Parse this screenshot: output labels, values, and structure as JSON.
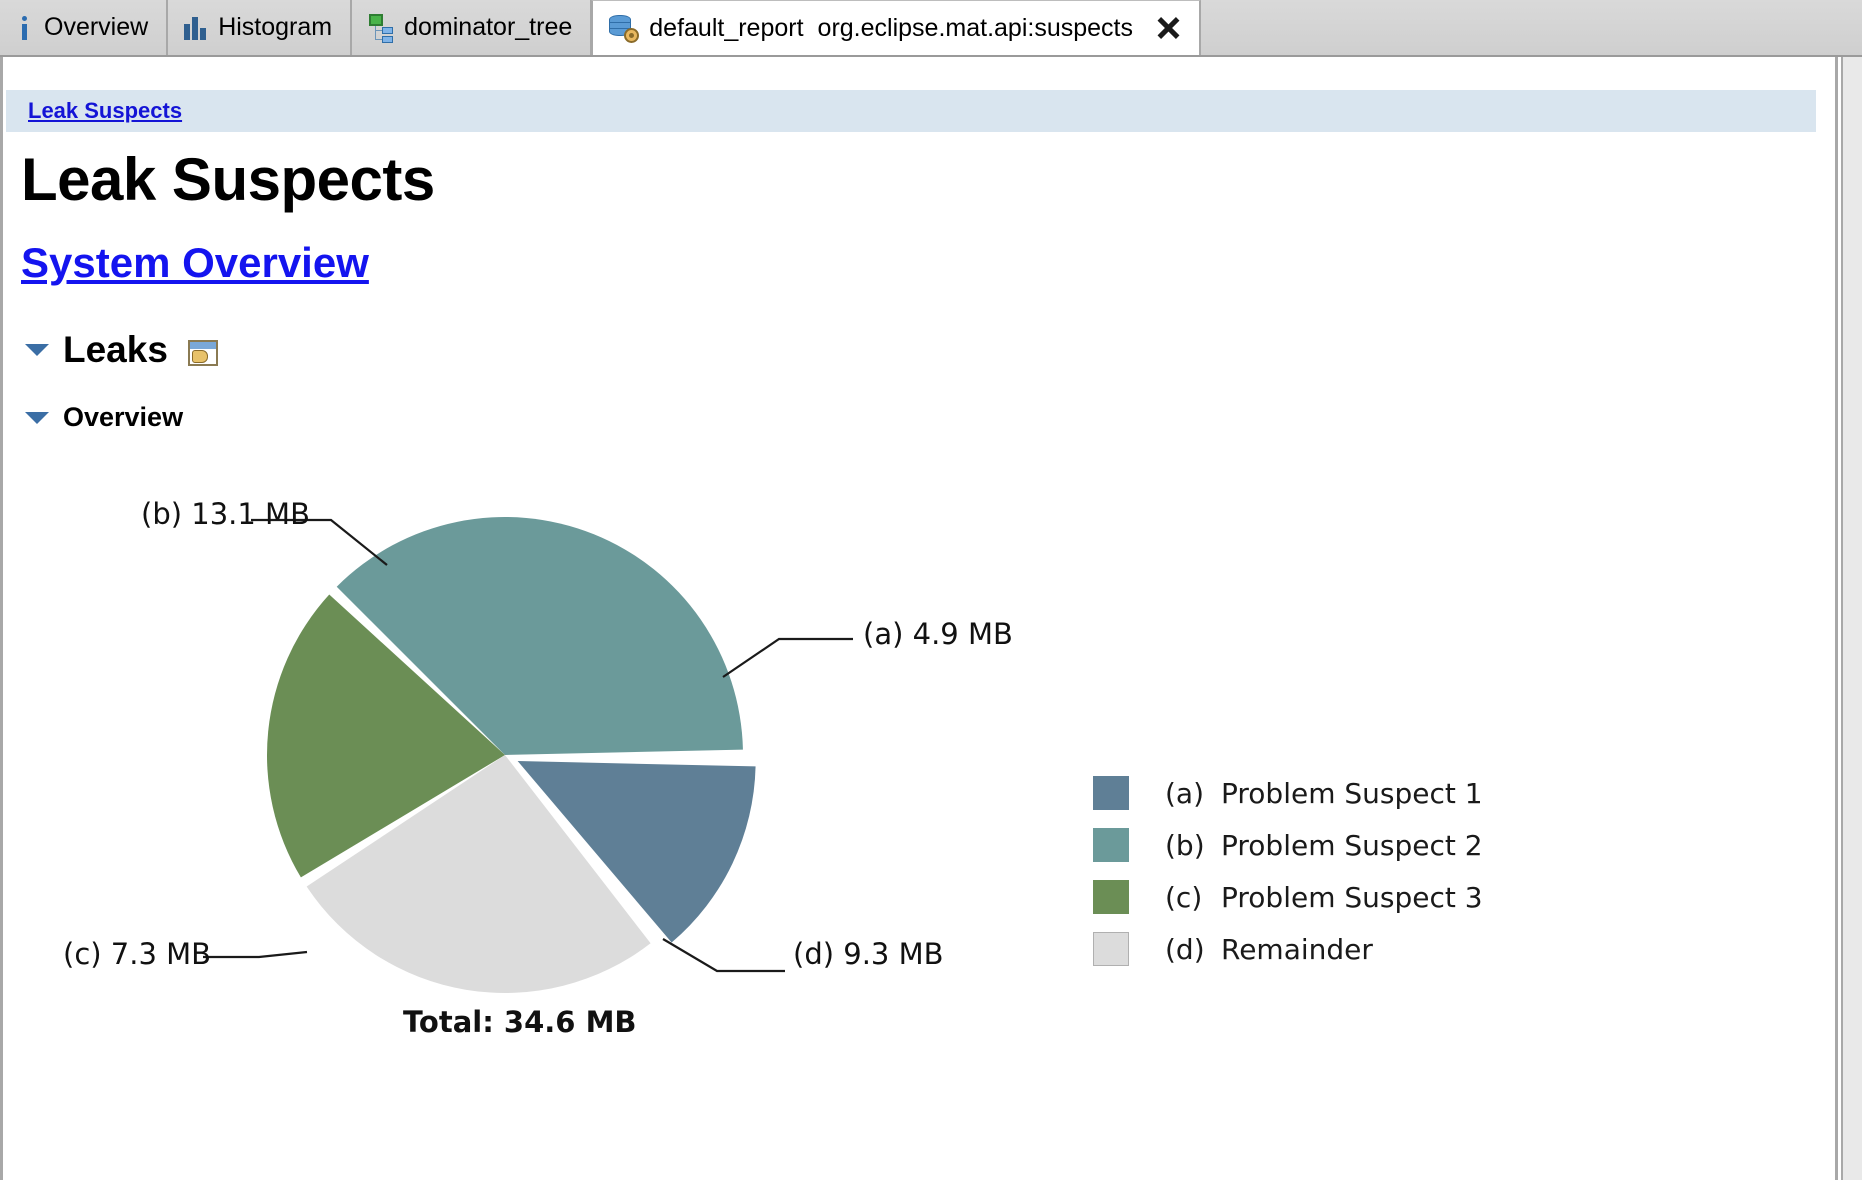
{
  "window": {
    "tabs": [
      {
        "label": "Overview",
        "icon": "info-icon",
        "active": false
      },
      {
        "label": "Histogram",
        "icon": "histogram-icon",
        "active": false
      },
      {
        "label": "dominator_tree",
        "icon": "dominator-tree-icon",
        "active": false
      },
      {
        "label": "default_report",
        "sublabel": "org.eclipse.mat.api:suspects",
        "icon": "report-icon",
        "active": true,
        "closable": true
      }
    ],
    "close_icon": "close-icon"
  },
  "report": {
    "breadcrumb": "Leak Suspects",
    "title": "Leak Suspects",
    "system_overview_link": "System Overview",
    "sections": [
      {
        "label": "Leaks",
        "expanded": true,
        "action_icon": "open-window-icon"
      },
      {
        "label": "Overview",
        "expanded": true
      }
    ]
  },
  "chart_data": {
    "type": "pie",
    "title": "",
    "unit": "MB",
    "total_label": "Total: 34.6 MB",
    "total": 34.6,
    "categories": [
      "(a) Problem Suspect 1",
      "(b) Problem Suspect 2",
      "(c) Problem Suspect 3",
      "(d) Remainder"
    ],
    "keys": [
      "(a)",
      "(b)",
      "(c)",
      "(d)"
    ],
    "values": [
      4.9,
      13.1,
      7.3,
      9.3
    ],
    "value_labels": [
      "(a)  4.9 MB",
      "(b)  13.1 MB",
      "(c)  7.3 MB",
      "(d)  9.3 MB"
    ],
    "colors": [
      "#5f7f96",
      "#6b9a9a",
      "#6b8e55",
      "#dcdcdc"
    ],
    "legend": {
      "position": "right",
      "entries": [
        {
          "key": "(a)",
          "label": "Problem Suspect 1",
          "color": "#5f7f96"
        },
        {
          "key": "(b)",
          "label": "Problem Suspect 2",
          "color": "#6b9a9a"
        },
        {
          "key": "(c)",
          "label": "Problem Suspect 3",
          "color": "#6b8e55"
        },
        {
          "key": "(d)",
          "label": "Remainder",
          "color": "#dcdcdc"
        }
      ]
    }
  },
  "theme": {
    "breadcrumb_bg": "#d9e5ef",
    "link_color": "#1414ef",
    "tabbar_bg": "#d4d4d4"
  }
}
